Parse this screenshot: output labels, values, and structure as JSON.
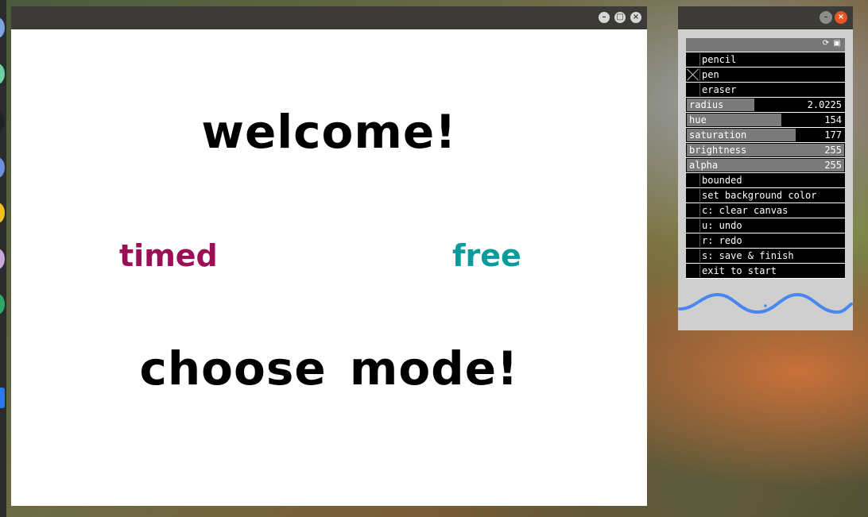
{
  "main_window": {
    "controls": {
      "minimize": "–",
      "maximize": "□",
      "close": "×"
    },
    "welcome_text": "welcome!",
    "modes": {
      "timed": "timed",
      "free": "free"
    },
    "choose_text": "choose mode!",
    "colors": {
      "timed": "#9a0f55",
      "free": "#0a9c9c"
    }
  },
  "gui_panel": {
    "controls": {
      "minimize": "–",
      "close": "×"
    },
    "header_icons": [
      "refresh-icon",
      "save-icon"
    ],
    "toggles_top": [
      {
        "label": "pencil",
        "checked": false
      },
      {
        "label": "pen",
        "checked": true
      },
      {
        "label": "eraser",
        "checked": false
      }
    ],
    "sliders": [
      {
        "label": "radius",
        "value": "2.0225",
        "level": 0.43
      },
      {
        "label": "hue",
        "value": "154",
        "level": 0.6
      },
      {
        "label": "saturation",
        "value": "177",
        "level": 0.69
      },
      {
        "label": "brightness",
        "value": "255",
        "level": 1.0
      },
      {
        "label": "alpha",
        "value": "255",
        "level": 1.0
      }
    ],
    "toggles_bottom": [
      {
        "label": "bounded",
        "checked": false
      },
      {
        "label": "set background color",
        "checked": false
      },
      {
        "label": "c: clear canvas",
        "checked": false
      },
      {
        "label": "u: undo",
        "checked": false
      },
      {
        "label": "r: redo",
        "checked": false
      },
      {
        "label": "s: save & finish",
        "checked": false
      },
      {
        "label": "exit to start",
        "checked": false
      }
    ],
    "wave_color": "#4a86f0"
  }
}
